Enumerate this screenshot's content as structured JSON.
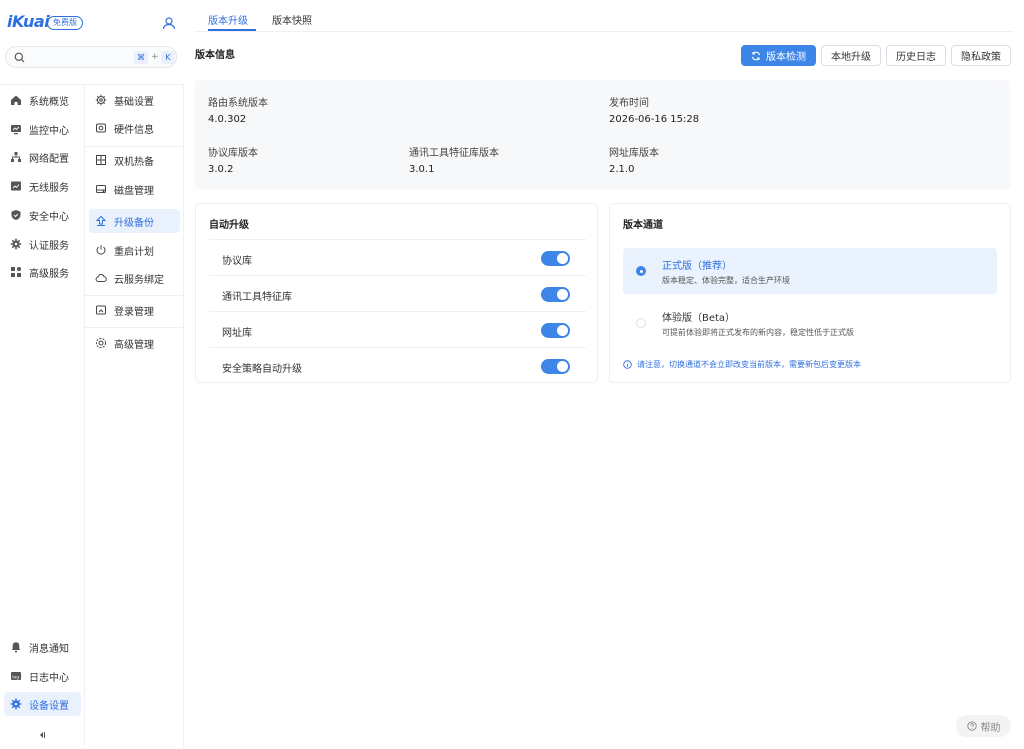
{
  "brand": {
    "logo": "iKuai",
    "badge": "免费版"
  },
  "search": {
    "placeholder": "",
    "key1": "⌘",
    "plus": "+",
    "key2": "K"
  },
  "nav1": {
    "items": [
      {
        "label": "系统概览",
        "icon": "home-icon"
      },
      {
        "label": "监控中心",
        "icon": "monitor-icon"
      },
      {
        "label": "网络配置",
        "icon": "network-icon"
      },
      {
        "label": "无线服务",
        "icon": "wireless-icon"
      },
      {
        "label": "安全中心",
        "icon": "shield-icon"
      },
      {
        "label": "认证服务",
        "icon": "gear-icon"
      },
      {
        "label": "高级服务",
        "icon": "apps-icon"
      }
    ],
    "bottom": [
      {
        "label": "消息通知",
        "icon": "bell-icon"
      },
      {
        "label": "日志中心",
        "icon": "log-icon"
      },
      {
        "label": "设备设置",
        "icon": "settings-icon",
        "active": true
      }
    ]
  },
  "nav2": {
    "items": [
      {
        "label": "基础设置",
        "icon": "gear-icon"
      },
      {
        "label": "硬件信息",
        "icon": "hardware-icon"
      },
      {
        "label": "双机热备",
        "icon": "dual-machine-icon"
      },
      {
        "label": "磁盘管理",
        "icon": "disk-icon"
      },
      {
        "label": "升级备份",
        "icon": "upgrade-icon",
        "active": true
      },
      {
        "label": "重启计划",
        "icon": "power-icon"
      },
      {
        "label": "云服务绑定",
        "icon": "cloud-icon"
      },
      {
        "label": "登录管理",
        "icon": "login-icon"
      },
      {
        "label": "高级管理",
        "icon": "advanced-icon"
      }
    ]
  },
  "tabs": [
    {
      "label": "版本升级",
      "active": true
    },
    {
      "label": "版本快照",
      "active": false
    }
  ],
  "version_info": {
    "title": "版本信息",
    "buttons": {
      "check": "版本检测",
      "local": "本地升级",
      "history": "历史日志",
      "privacy": "隐私政策"
    },
    "fields": {
      "router_label": "路由系统版本",
      "router_value": "4.0.302",
      "release_label": "发布时间",
      "release_value": "2026-06-16 15:28",
      "protocol_label": "协议库版本",
      "protocol_value": "3.0.2",
      "tool_label": "通讯工具特征库版本",
      "tool_value": "3.0.1",
      "url_label": "网址库版本",
      "url_value": "2.1.0"
    }
  },
  "auto_upgrade": {
    "title": "自动升级",
    "rows": [
      {
        "label": "协议库",
        "on": true
      },
      {
        "label": "通讯工具特征库",
        "on": true
      },
      {
        "label": "网址库",
        "on": true
      },
      {
        "label": "安全策略自动升级",
        "on": true
      }
    ]
  },
  "channel": {
    "title": "版本通道",
    "options": [
      {
        "name": "正式版（推荐）",
        "desc": "版本稳定、体验完整，适合生产环境",
        "selected": true
      },
      {
        "name": "体验版（Beta）",
        "desc": "可提前体验即将正式发布的新内容，稳定性低于正式版",
        "selected": false
      }
    ],
    "notice": "请注意，切换通道不会立即改变当前版本，需要新包后变更版本"
  },
  "help": {
    "label": "帮助"
  },
  "colors": {
    "accent": "#3d86e8",
    "accent_text": "#2f6fe0"
  }
}
